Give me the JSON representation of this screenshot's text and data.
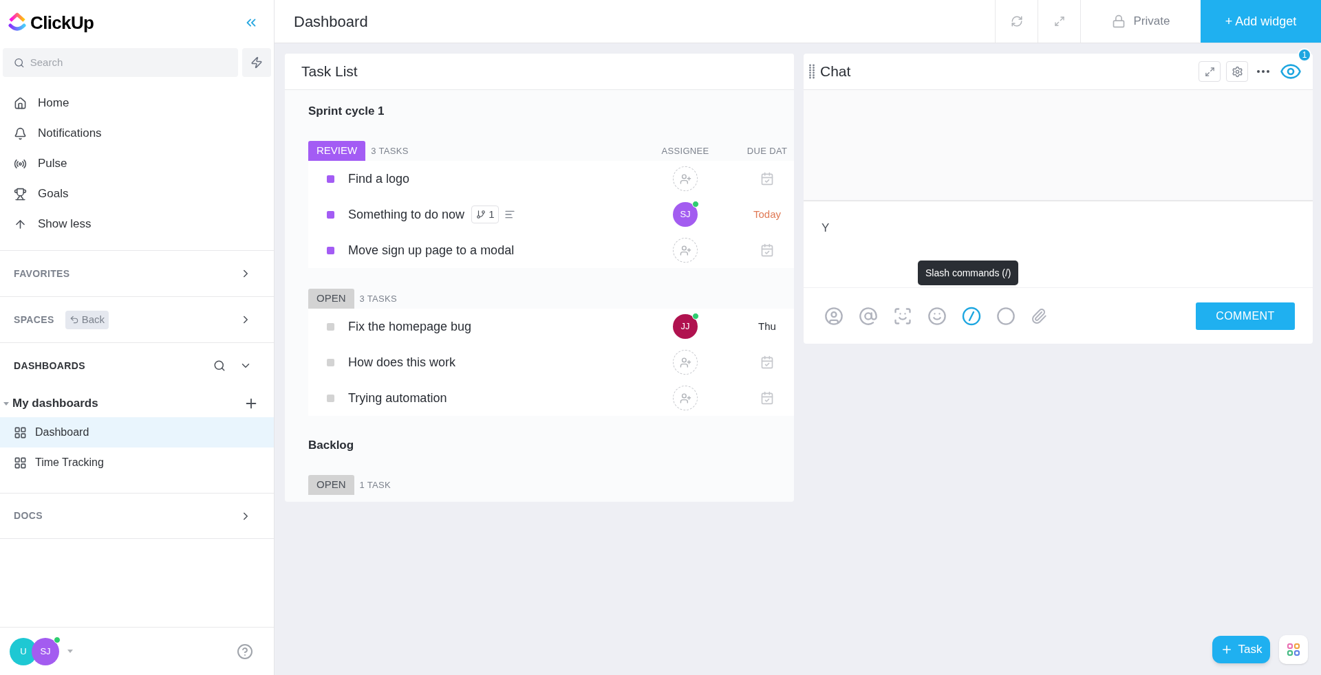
{
  "sidebar": {
    "logo": "ClickUp",
    "search": {
      "placeholder": "Search"
    },
    "nav": [
      {
        "label": "Home"
      },
      {
        "label": "Notifications"
      },
      {
        "label": "Pulse"
      },
      {
        "label": "Goals"
      },
      {
        "label": "Show less"
      }
    ],
    "favorites": {
      "label": "FAVORITES"
    },
    "spaces": {
      "label": "SPACES",
      "back": "Back"
    },
    "dashboards": {
      "label": "DASHBOARDS",
      "group": {
        "label": "My dashboards",
        "expanded": true,
        "children": [
          {
            "label": "Dashboard",
            "selected": true
          },
          {
            "label": "Time Tracking",
            "selected": false
          }
        ]
      }
    },
    "docs": {
      "label": "DOCS"
    },
    "users": [
      {
        "initials": "U",
        "color": "#1ec8d3",
        "online": false
      },
      {
        "initials": "SJ",
        "color": "#a35cf0",
        "online": true
      }
    ]
  },
  "topbar": {
    "title": "Dashboard",
    "private": "Private",
    "add_widget": "+ Add widget"
  },
  "task_list": {
    "title": "Task List",
    "columns": [
      "ASSIGNEE",
      "DUE DAT"
    ],
    "lists": [
      {
        "title": "Sprint cycle 1",
        "statuses": [
          {
            "status": "REVIEW",
            "color": "#a35cf4",
            "count": "3 TASKS",
            "tasks": [
              {
                "name": "Find a logo"
              },
              {
                "name": "Something to do now",
                "subtasks": "1",
                "has_description": true,
                "assignee": {
                  "initials": "SJ",
                  "color": "#a35cf0",
                  "online": true
                },
                "due": "Today",
                "due_soon": true
              },
              {
                "name": "Move sign up page to a modal"
              }
            ]
          },
          {
            "status": "OPEN",
            "color": "#d3d3d3",
            "count": "3 TASKS",
            "tasks": [
              {
                "name": "Fix the homepage bug",
                "assignee": {
                  "initials": "JJ",
                  "color": "#b0124f",
                  "online": true
                },
                "due": "Thu",
                "due_soon": false
              },
              {
                "name": "How does this work"
              },
              {
                "name": "Trying automation"
              }
            ]
          }
        ]
      },
      {
        "title": "Backlog",
        "statuses": [
          {
            "status": "OPEN",
            "color": "#d3d3d3",
            "count": "1 TASK"
          }
        ]
      }
    ]
  },
  "chat": {
    "title": "Chat",
    "watchers": "1",
    "input": "Y",
    "tooltip": "Slash commands (/)",
    "comment": "COMMENT"
  },
  "fab": {
    "task": "Task"
  }
}
